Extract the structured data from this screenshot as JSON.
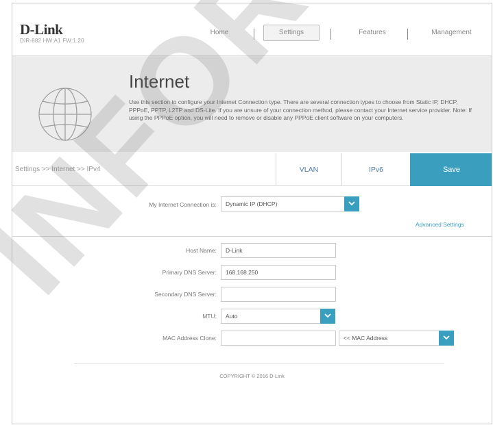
{
  "header": {
    "logo": "D-Link",
    "model": "DIR-882 HW:A1 FW:1.20",
    "nav": {
      "home": "Home",
      "settings": "Settings",
      "features": "Features",
      "management": "Management"
    }
  },
  "banner": {
    "title": "Internet",
    "description": "Use this section to configure your Internet Connection type. There are several connection types to choose from Static IP, DHCP, PPPoE, PPTP, L2TP and DS-Lite. If you are unsure of your connection method, please contact your Internet service provider. Note: If using the PPPoE option, you will need to remove or disable any PPPoE client software on your computers.",
    "icon": "globe-icon"
  },
  "subbar": {
    "breadcrumb": "Settings >> Internet >> IPv4",
    "tabs": {
      "vlan": "VLAN",
      "ipv6": "IPv6",
      "save": "Save"
    }
  },
  "form": {
    "connection_label": "My Internet Connection is:",
    "connection_value": "Dynamic IP (DHCP)",
    "advanced_link": "Advanced Settings",
    "host_name_label": "Host Name:",
    "host_name_value": "D-Link",
    "primary_dns_label": "Primary DNS Server:",
    "primary_dns_value": "168.168.250",
    "secondary_dns_label": "Secondary DNS Server:",
    "secondary_dns_value": "",
    "mtu_label": "MTU:",
    "mtu_value": "Auto",
    "mac_clone_label": "MAC Address Clone:",
    "mac_clone_value": "",
    "mac_select_value": "<< MAC Address"
  },
  "footer": {
    "copyright": "COPYRIGHT © 2016 D-Link"
  },
  "watermark": "INFORMATION",
  "colors": {
    "accent": "#3a9fbf",
    "banner_bg": "#ececec"
  }
}
